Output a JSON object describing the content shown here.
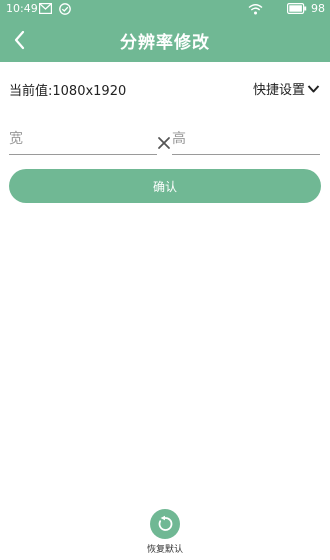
{
  "status_bar": {
    "time": "10:49",
    "icons": [
      "mail-icon",
      "check-circle-icon",
      "wifi-icon",
      "battery-icon"
    ],
    "battery": "98"
  },
  "header": {
    "back_icon": "chevron-left-icon",
    "title": "分辨率修改"
  },
  "current_value": "当前值:1080x1920",
  "quick_settings": {
    "label": "快捷设置",
    "icon": "chevron-down-icon"
  },
  "inputs": {
    "width_placeholder": "宽",
    "width_value": "",
    "height_placeholder": "高",
    "height_value": "",
    "separator_icon": "times-icon"
  },
  "confirm_label": "确认",
  "restore": {
    "icon": "restore-icon",
    "label": "恢复默认"
  },
  "colors": {
    "accent": "#70b894",
    "background": "#ffffff",
    "text": "#222222",
    "placeholder": "#999999"
  }
}
